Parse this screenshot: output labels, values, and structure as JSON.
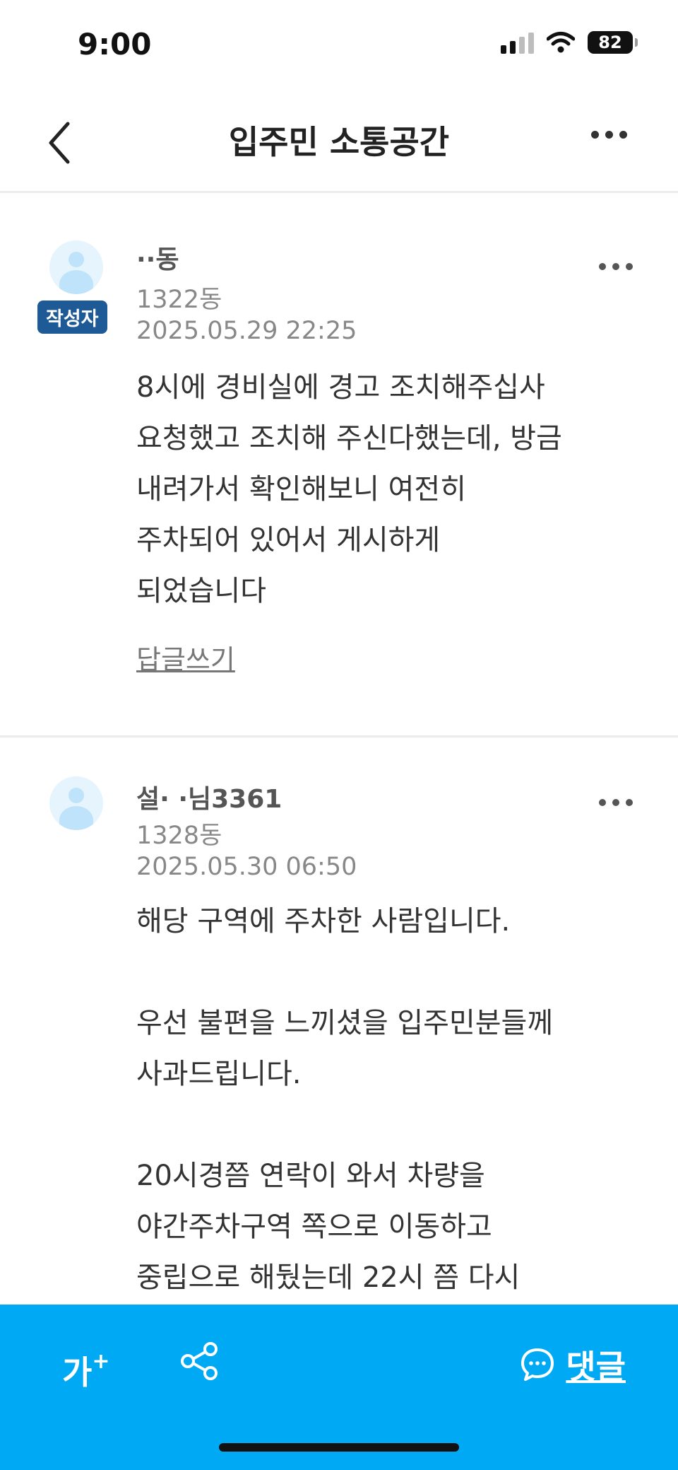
{
  "status_bar": {
    "time": "9:00",
    "battery": "82"
  },
  "nav": {
    "title": "입주민 소통공간"
  },
  "comments": [
    {
      "name": "··동",
      "author_badge": "작성자",
      "dong": "1322동",
      "date": "2025.05.29 22:25",
      "lines": [
        "8시에 경비실에 경고 조치해주십사",
        "요청했고 조치해 주신다했는데, 방금",
        "내려가서 확인해보니 여전히",
        "주차되어 있어서 게시하게",
        "되었습니다"
      ],
      "reply_label": "답글쓰기"
    },
    {
      "name": "설·         ·님3361",
      "dong": "1328동",
      "date": "2025.05.30 06:50",
      "lines": [
        "해당 구역에 주차한 사람입니다.",
        "",
        "우선 불편을 느끼셨을 입주민분들께",
        "사과드립니다.",
        "",
        "20시경쯤 연락이 와서 차량을",
        "야간주차구역 쪽으로 이동하고",
        "중립으로 해뒀는데 22시 쯤 다시"
      ]
    }
  ],
  "bottom_bar": {
    "font_size_label": "가",
    "font_size_plus": "+",
    "comment_label": "댓글"
  },
  "colors": {
    "accent": "#00a9f4",
    "badge": "#1e5a96"
  },
  "icons": [
    "back-chevron-icon",
    "more-icon",
    "avatar-icon",
    "share-icon",
    "chat-bubble-icon"
  ]
}
